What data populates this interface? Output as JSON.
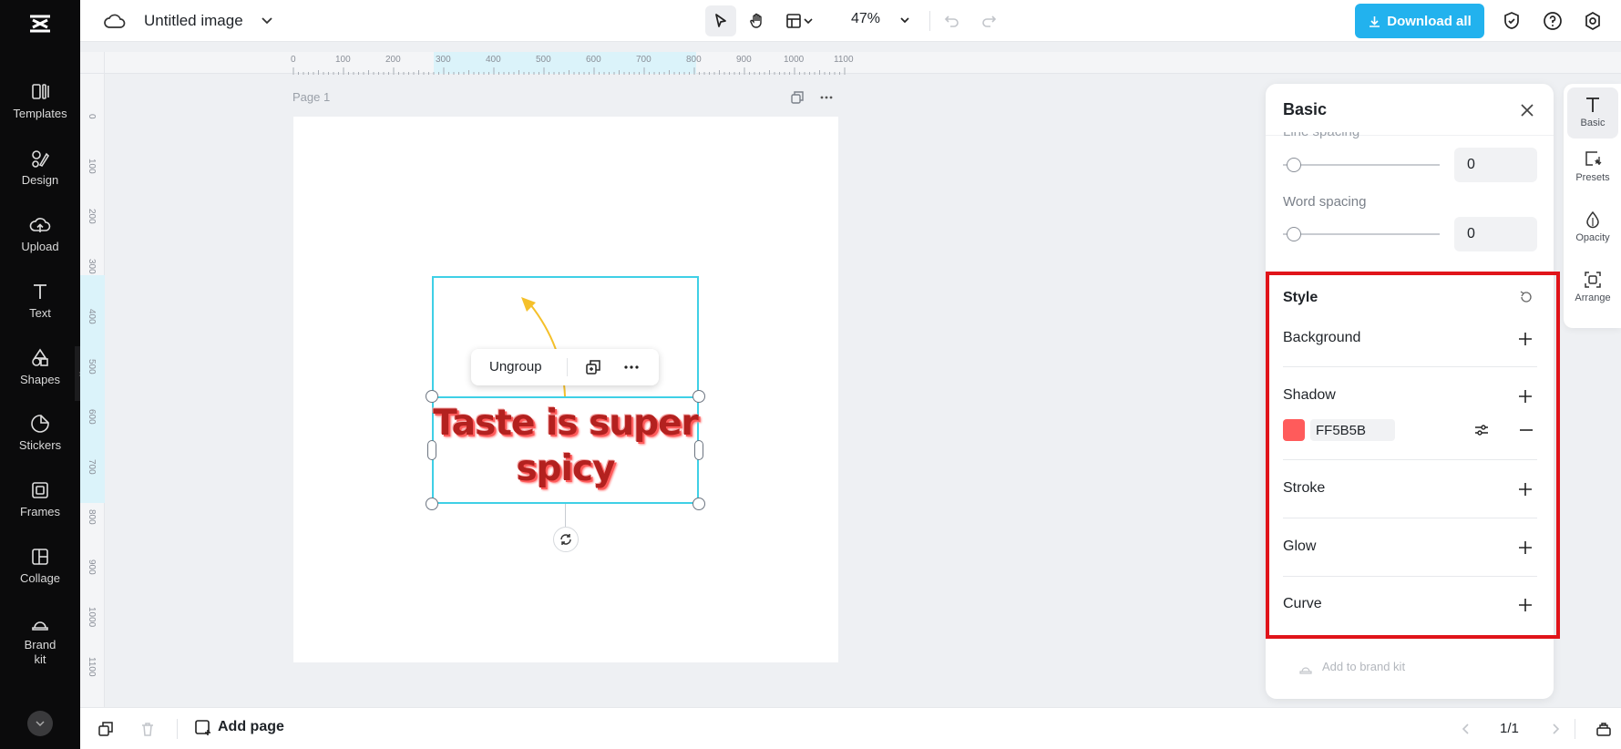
{
  "app": {
    "title": "Untitled image"
  },
  "sidebar": {
    "items": [
      {
        "label": "Templates",
        "icon": "templates-icon"
      },
      {
        "label": "Design",
        "icon": "design-icon"
      },
      {
        "label": "Upload",
        "icon": "upload-icon"
      },
      {
        "label": "Text",
        "icon": "text-icon"
      },
      {
        "label": "Shapes",
        "icon": "shapes-icon"
      },
      {
        "label": "Stickers",
        "icon": "stickers-icon"
      },
      {
        "label": "Frames",
        "icon": "frames-icon"
      },
      {
        "label": "Collage",
        "icon": "collage-icon"
      },
      {
        "label": "Brand kit",
        "icon": "brand-kit-icon"
      }
    ]
  },
  "toolbar": {
    "zoom": "47%",
    "download_label": "Download all"
  },
  "ruler": {
    "h_ticks": [
      "0",
      "100",
      "200",
      "300",
      "400",
      "500",
      "600",
      "700",
      "800",
      "900",
      "1000",
      "1100"
    ],
    "v_ticks": [
      "0",
      "100",
      "200",
      "300",
      "400",
      "500",
      "600",
      "700",
      "800",
      "900",
      "1000",
      "1100"
    ]
  },
  "canvas": {
    "page_label": "Page 1",
    "float_toolbar": {
      "ungroup_label": "Ungroup"
    },
    "text_line1": "Taste is super",
    "text_line2": "spicy"
  },
  "panel": {
    "title": "Basic",
    "line_spacing_label": "Line spacing",
    "line_spacing_value": "0",
    "word_spacing_label": "Word spacing",
    "word_spacing_value": "0",
    "style_label": "Style",
    "background_label": "Background",
    "shadow_label": "Shadow",
    "shadow_color_hex": "FF5B5B",
    "shadow_color": "#ff5b5b",
    "stroke_label": "Stroke",
    "glow_label": "Glow",
    "curve_label": "Curve",
    "add_to_brand_kit": "Add to brand kit"
  },
  "rail": {
    "items": [
      {
        "label": "Basic",
        "icon": "text-t-icon"
      },
      {
        "label": "Presets",
        "icon": "presets-icon"
      },
      {
        "label": "Opacity",
        "icon": "opacity-drop-icon"
      },
      {
        "label": "Arrange",
        "icon": "arrange-icon"
      }
    ]
  },
  "bottombar": {
    "add_page_label": "Add page",
    "pager": "1/1"
  },
  "colors": {
    "accent": "#22b2ee",
    "selection": "#3fd0e6",
    "highlight": "#e0141a",
    "text_art": "#b3211f"
  }
}
